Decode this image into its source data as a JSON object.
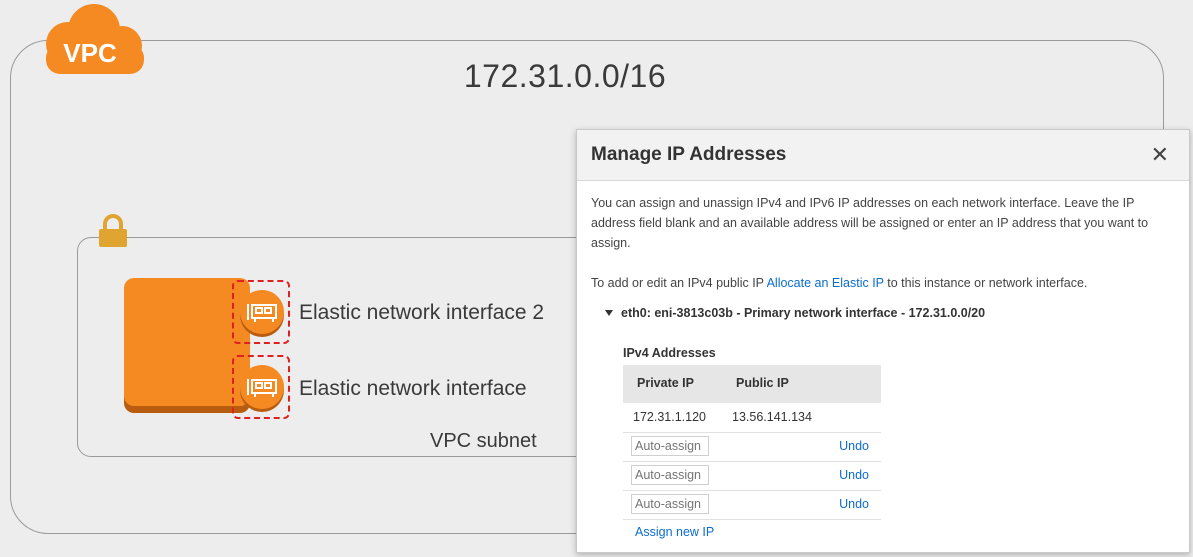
{
  "diagram": {
    "vpc_badge": "VPC",
    "vpc_cidr": "172.31.0.0/16",
    "subnet_label": "VPC subnet",
    "eni_labels": [
      "Elastic network interface 2",
      "Elastic network interface"
    ]
  },
  "colors": {
    "aws_orange": "#f58a23",
    "link_blue": "#0c6ccc",
    "highlight_red": "#e02020"
  },
  "dialog": {
    "title": "Manage IP Addresses",
    "close_glyph": "✕",
    "description": "You can assign and unassign IPv4 and IPv6 IP addresses on each network interface. Leave the IP address field blank and an available address will be assigned or enter an IP address that you want to assign.",
    "public_ip_prefix": "To add or edit an IPv4 public IP",
    "public_ip_link": "Allocate an Elastic IP",
    "public_ip_suffix": "to this instance or network interface.",
    "interface_line": "eth0: eni-3813c03b - Primary network interface - 172.31.0.0/20",
    "ipv4_title": "IPv4 Addresses",
    "columns": [
      "Private IP",
      "Public IP"
    ],
    "assigned": {
      "private_ip": "172.31.1.120",
      "public_ip": "13.56.141.134"
    },
    "auto_rows": [
      {
        "placeholder": "Auto-assign",
        "action": "Undo"
      },
      {
        "placeholder": "Auto-assign",
        "action": "Undo"
      },
      {
        "placeholder": "Auto-assign",
        "action": "Undo"
      }
    ],
    "assign_new": "Assign new IP"
  }
}
